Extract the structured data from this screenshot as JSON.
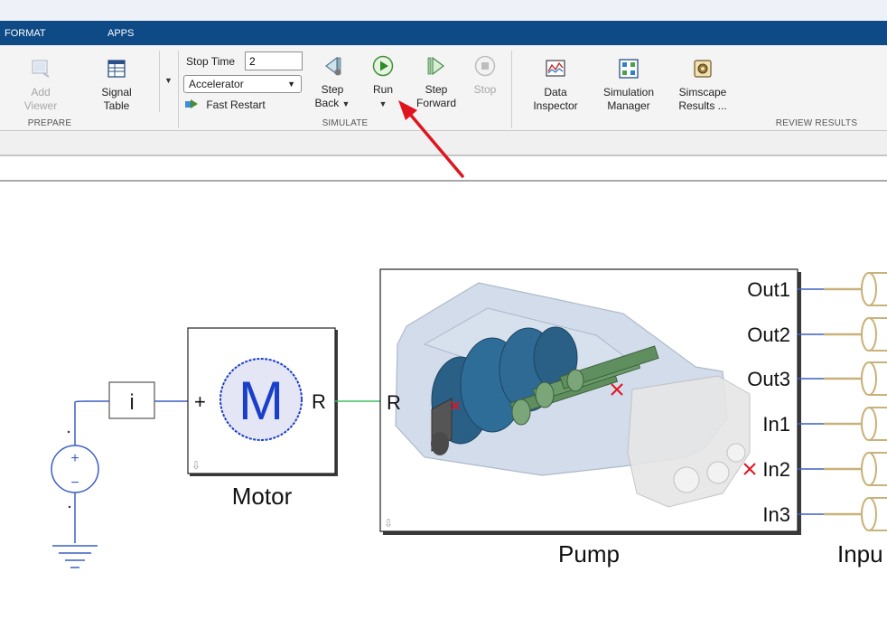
{
  "tabs": [
    {
      "label": "FORMAT"
    },
    {
      "label": "APPS"
    }
  ],
  "ribbon": {
    "prepare": {
      "title": "PREPARE",
      "add_viewer": {
        "line1": "Add",
        "line2": "Viewer"
      },
      "signal_table": {
        "line1": "Signal",
        "line2": "Table"
      }
    },
    "simulate": {
      "title": "SIMULATE",
      "stop_time_label": "Stop Time",
      "stop_time_value": "2",
      "mode_value": "Accelerator",
      "fast_restart_label": "Fast Restart",
      "step_back": {
        "line1": "Step",
        "line2": "Back"
      },
      "run": {
        "line1": "Run"
      },
      "step_forward": {
        "line1": "Step",
        "line2": "Forward"
      },
      "stop": {
        "line1": "Stop"
      }
    },
    "review": {
      "title": "REVIEW RESULTS",
      "data_inspector": {
        "line1": "Data",
        "line2": "Inspector"
      },
      "simulation_manager": {
        "line1": "Simulation",
        "line2": "Manager"
      },
      "simscape_results": {
        "line1": "Simscape",
        "line2": "Results ..."
      }
    }
  },
  "colors": {
    "tabbar": "#0d4a86",
    "signal_line": "#3b5fc4",
    "mech_line": "#3fbf5f",
    "hydraulic_line": "#c8b27a",
    "annotation_arrow": "#e0141e",
    "unconnected_mark": "#e0141e"
  },
  "model": {
    "current_block_label": "i",
    "motor": {
      "label": "Motor",
      "symbol": "M",
      "port_plus": "+",
      "port_r": "R"
    },
    "pump": {
      "label": "Pump",
      "port_r": "R",
      "ports": [
        "Out1",
        "Out2",
        "Out3",
        "In1",
        "In2",
        "In3"
      ]
    },
    "source": {
      "plus": "+",
      "minus": "−"
    },
    "inputs_label": "Inpu"
  }
}
